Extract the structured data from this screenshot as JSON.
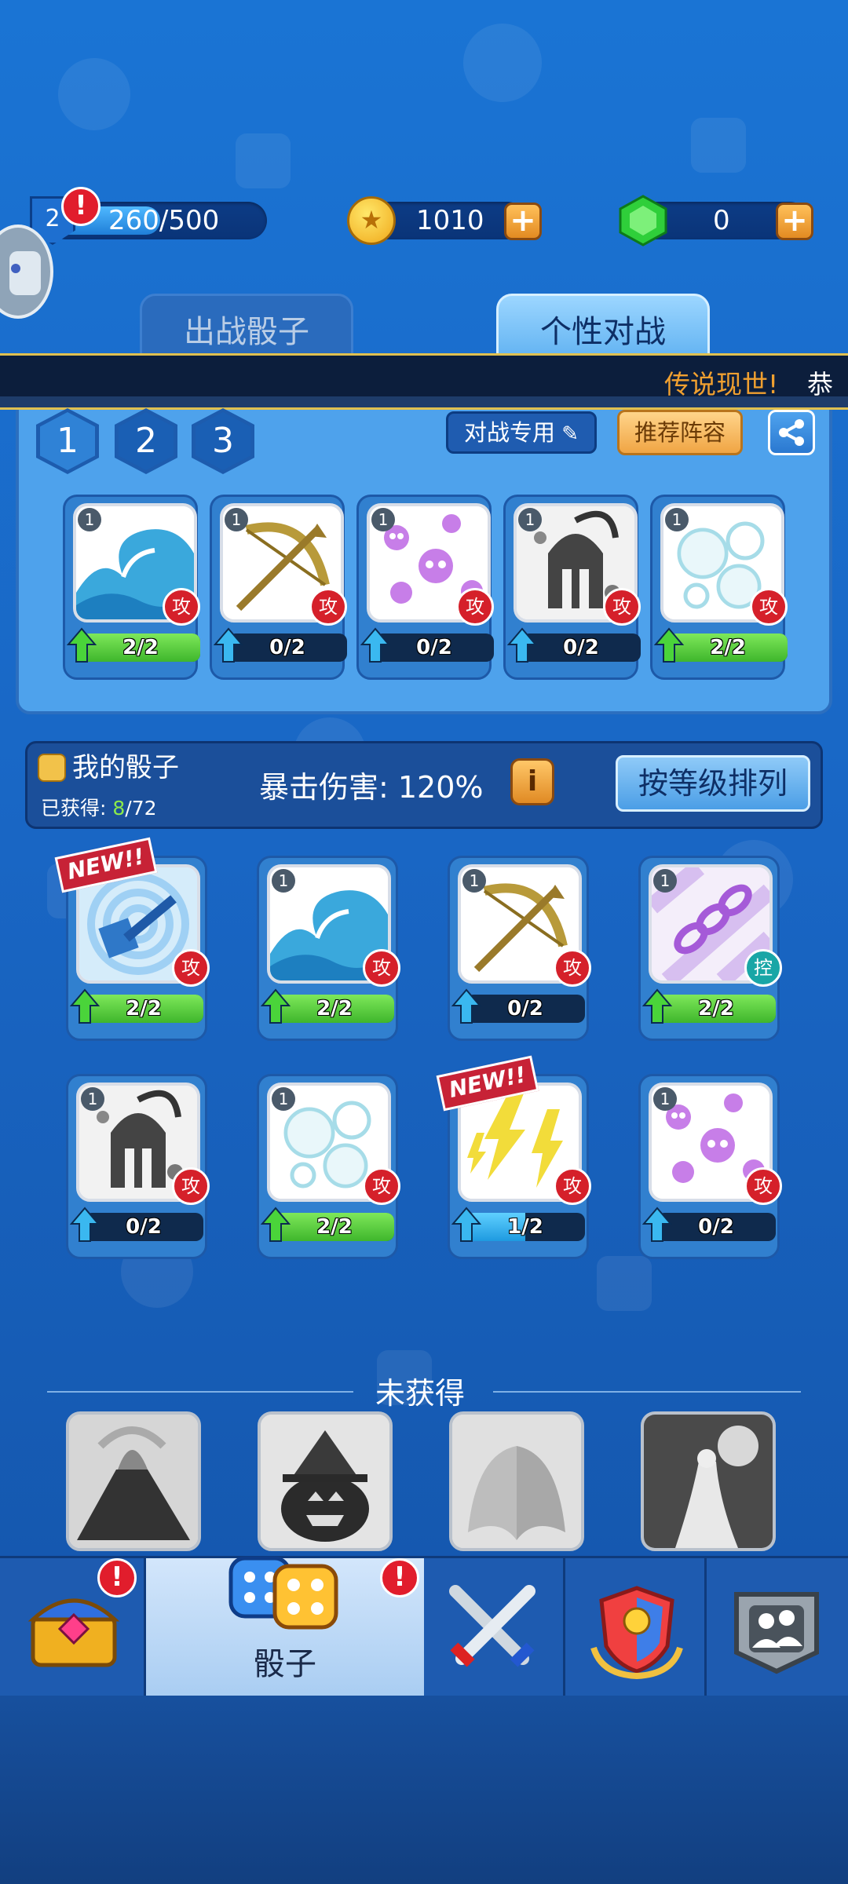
{
  "player": {
    "level": "2",
    "xp": "260/500",
    "xp_fraction": 0.52
  },
  "currency": {
    "coins": "1010",
    "gems": "0"
  },
  "tabs": {
    "left": "出战骰子",
    "right": "个性对战"
  },
  "ticker": {
    "highlight": "传说现世!",
    "text": "恭喜"
  },
  "deck": {
    "slots": [
      "1",
      "2",
      "3"
    ],
    "battle_only_label": "对战专用",
    "recommend_label": "推荐阵容",
    "dice": [
      {
        "icon": "wave-icon",
        "level": "1",
        "tag": "攻",
        "progress": "2/2",
        "fraction": 1.0,
        "color": "green"
      },
      {
        "icon": "crossbow-icon",
        "level": "1",
        "tag": "攻",
        "progress": "0/2",
        "fraction": 0,
        "color": "blue"
      },
      {
        "icon": "skulls-icon",
        "level": "1",
        "tag": "攻",
        "progress": "0/2",
        "fraction": 0,
        "color": "blue"
      },
      {
        "icon": "spartan-helmet-icon",
        "level": "1",
        "tag": "攻",
        "progress": "0/2",
        "fraction": 0,
        "color": "blue"
      },
      {
        "icon": "bubbles-icon",
        "level": "1",
        "tag": "攻",
        "progress": "2/2",
        "fraction": 1.0,
        "color": "green"
      }
    ]
  },
  "collection": {
    "title": "我的骰子",
    "owned_label": "已获得:",
    "owned_count": "8",
    "owned_total": "/72",
    "crit_label": "暴击伤害: 120%",
    "sort_button": "按等级排列",
    "new_label": "NEW!!",
    "dice": [
      {
        "icon": "hammer-icon",
        "level": "",
        "tag": "攻",
        "progress": "2/2",
        "fraction": 1.0,
        "color": "green",
        "is_new": true
      },
      {
        "icon": "wave-icon",
        "level": "1",
        "tag": "攻",
        "progress": "2/2",
        "fraction": 1.0,
        "color": "green",
        "is_new": false
      },
      {
        "icon": "crossbow-icon",
        "level": "1",
        "tag": "攻",
        "progress": "0/2",
        "fraction": 0,
        "color": "blue",
        "is_new": false
      },
      {
        "icon": "chain-icon",
        "level": "1",
        "tag": "控",
        "progress": "2/2",
        "fraction": 1.0,
        "color": "green",
        "is_new": false
      },
      {
        "icon": "spartan-helmet-icon",
        "level": "1",
        "tag": "攻",
        "progress": "0/2",
        "fraction": 0,
        "color": "blue",
        "is_new": false
      },
      {
        "icon": "bubbles-icon",
        "level": "1",
        "tag": "攻",
        "progress": "2/2",
        "fraction": 1.0,
        "color": "green",
        "is_new": false
      },
      {
        "icon": "lightning-icon",
        "level": "",
        "tag": "攻",
        "progress": "1/2",
        "fraction": 0.5,
        "color": "blue",
        "is_new": true
      },
      {
        "icon": "skulls-icon",
        "level": "1",
        "tag": "攻",
        "progress": "0/2",
        "fraction": 0,
        "color": "blue",
        "is_new": false
      }
    ]
  },
  "unowned": {
    "title": "未获得",
    "dice": [
      "volcano-icon",
      "pumpkin-witch-icon",
      "angel-wings-icon",
      "goddess-icon"
    ]
  },
  "nav": {
    "dice_label": "骰子",
    "badge": "!",
    "items": [
      "treasure-chest-icon",
      "dice-icon",
      "crossed-swords-icon",
      "clan-shield-icon",
      "friends-icon"
    ]
  },
  "colors": {
    "accent_gold": "#f0a030",
    "alert_red": "#e11d2c"
  }
}
